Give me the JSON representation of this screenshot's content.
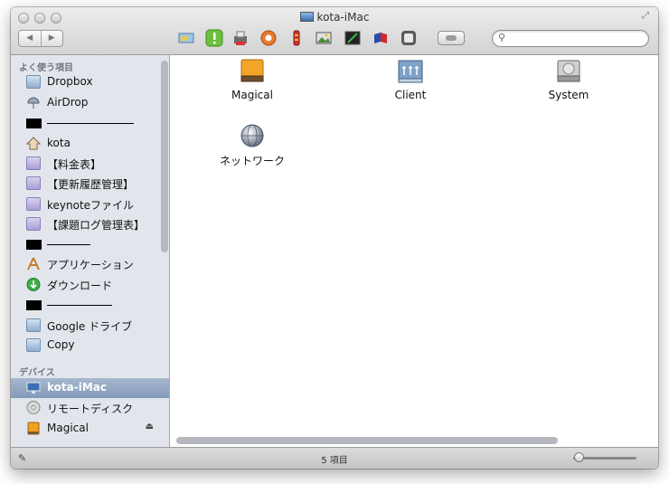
{
  "window": {
    "title": "kota-iMac"
  },
  "toolbar": {
    "back_glyph": "◀",
    "forward_glyph": "▶",
    "search_placeholder": "",
    "search_value": ""
  },
  "sidebar": {
    "favorites_header": "よく使う項目",
    "favorites": [
      {
        "label": "Dropbox",
        "icon": "dropbox-folder-icon"
      },
      {
        "label": "AirDrop",
        "icon": "airdrop-icon"
      },
      {
        "label": "kota",
        "icon": "home-icon"
      },
      {
        "label": "【料金表】",
        "icon": "folder-icon"
      },
      {
        "label": "【更新履歴管理】",
        "icon": "folder-icon"
      },
      {
        "label": "keynoteファイル",
        "icon": "folder-icon"
      },
      {
        "label": "【課題ログ管理表】",
        "icon": "folder-icon"
      },
      {
        "label": "アプリケーション",
        "icon": "applications-icon"
      },
      {
        "label": "ダウンロード",
        "icon": "downloads-icon"
      },
      {
        "label": "Google ドライブ",
        "icon": "folder-icon"
      },
      {
        "label": "Copy",
        "icon": "folder-icon"
      }
    ],
    "devices_header": "デバイス",
    "devices": [
      {
        "label": "kota-iMac",
        "icon": "imac-icon",
        "selected": true
      },
      {
        "label": "リモートディスク",
        "icon": "remote-disc-icon"
      },
      {
        "label": "Magical",
        "icon": "drive-icon",
        "eject": true
      }
    ]
  },
  "content": {
    "items": [
      {
        "label": "Magical",
        "icon": "external-drive-icon"
      },
      {
        "label": "Client",
        "icon": "network-server-icon"
      },
      {
        "label": "System",
        "icon": "hard-disk-icon"
      },
      {
        "label": "ネットワーク",
        "icon": "network-globe-icon"
      }
    ]
  },
  "statusbar": {
    "count_text": "5 項目",
    "zoom_fraction": 0.05
  },
  "colors": {
    "sidebar_bg": "#e2e6ec",
    "selection": "#8299b9",
    "magical_orange": "#f0a020"
  }
}
